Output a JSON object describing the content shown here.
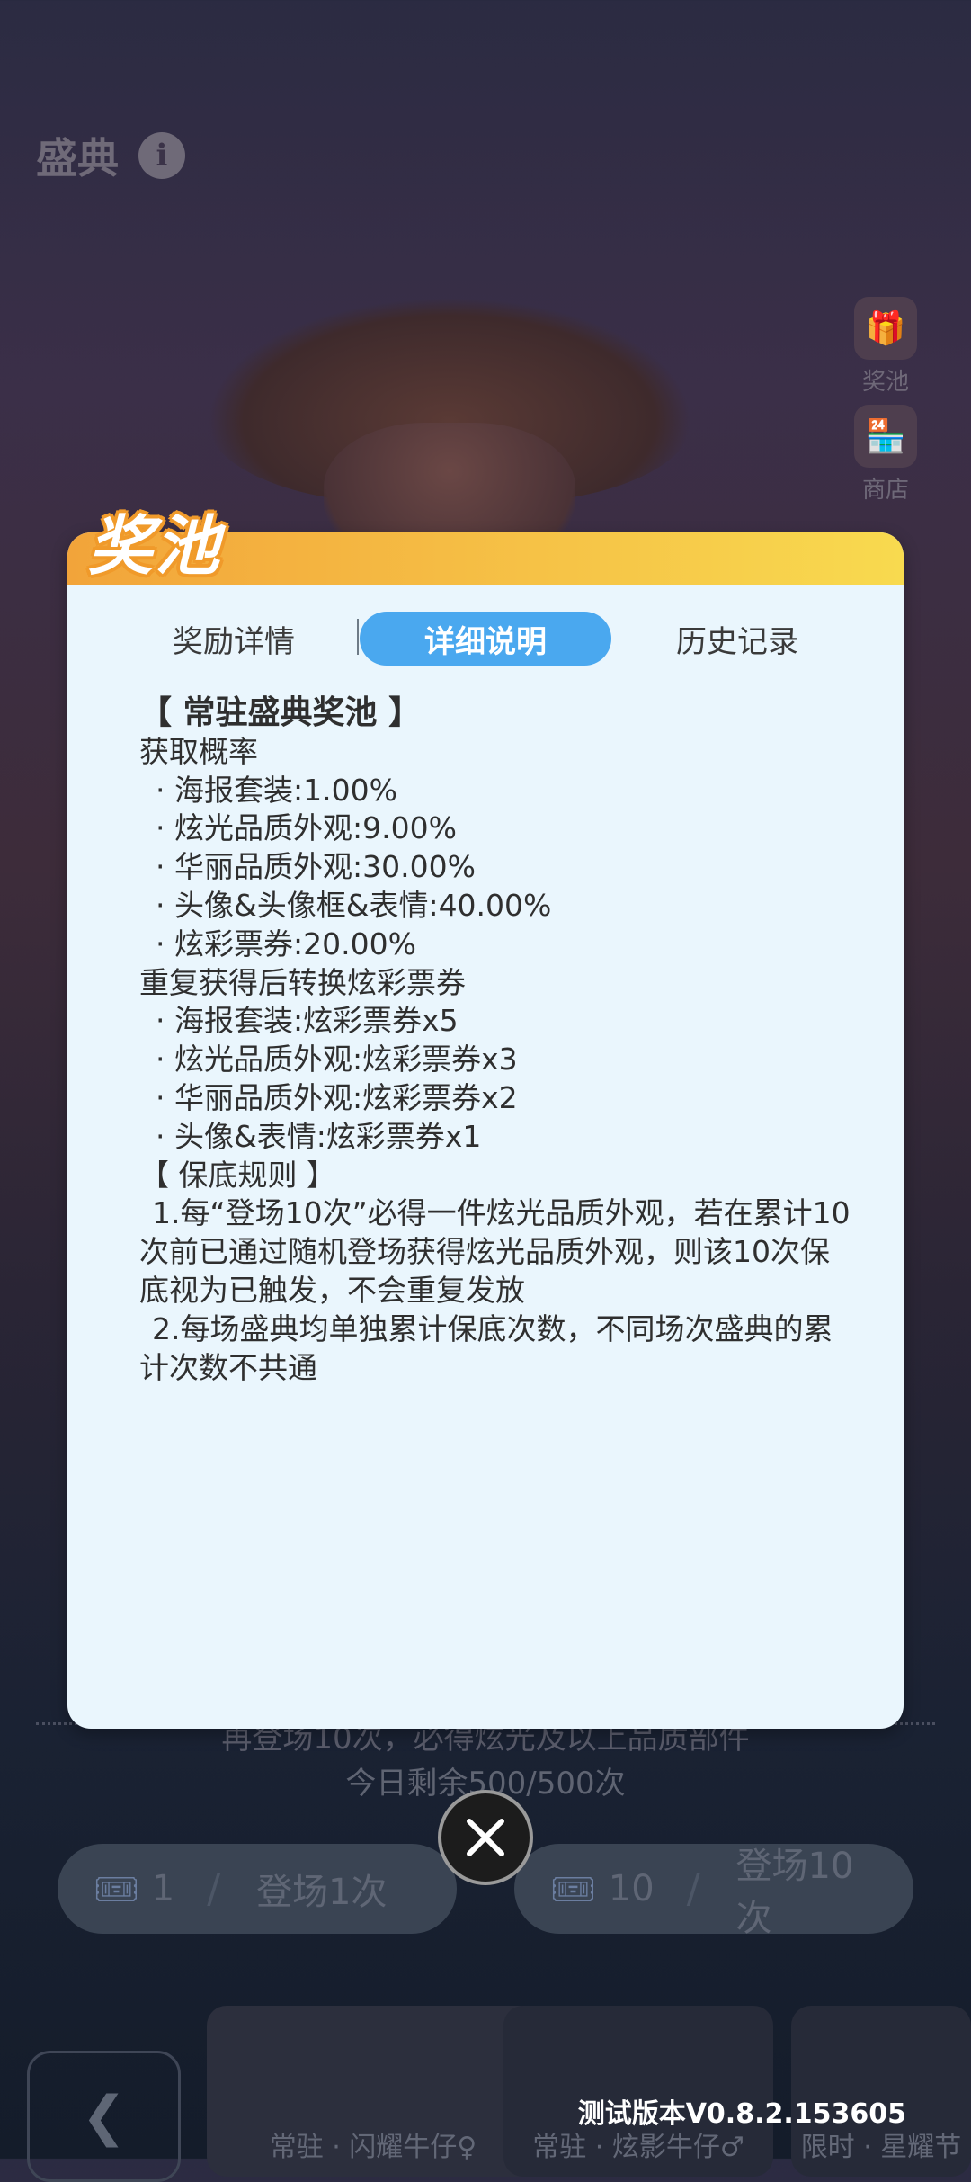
{
  "header": {
    "title": "盛典"
  },
  "side_buttons": [
    {
      "label": "奖池",
      "icon": "gift-icon"
    },
    {
      "label": "商店",
      "icon": "shop-icon"
    }
  ],
  "background": {
    "hint_text": "再登场10次，必得炫光及以上品质部件",
    "remaining": "今日剩余500/500次",
    "draw_one": {
      "count": "1",
      "label": "登场1次"
    },
    "draw_ten": {
      "count": "10",
      "label": "登场10次"
    },
    "cards": [
      "常驻 · 闪耀牛仔♀",
      "常驻 · 炫影牛仔♂",
      "限时 · 星耀节"
    ],
    "version": "测试版本V0.8.2.153605"
  },
  "modal": {
    "title": "奖池",
    "tabs": [
      "奖励详情",
      "详细说明",
      "历史记录"
    ],
    "active_tab": "详细说明",
    "section_title": "【 常驻盛典奖池 】",
    "prob_heading": "获取概率",
    "probabilities": [
      "· 海报套装:1.00%",
      "· 炫光品质外观:9.00%",
      "· 华丽品质外观:30.00%",
      "· 头像&头像框&表情:40.00%",
      "· 炫彩票券:20.00%"
    ],
    "convert_heading": "重复获得后转换炫彩票券",
    "conversions": [
      "· 海报套装:炫彩票券x5",
      "· 炫光品质外观:炫彩票券x3",
      "· 华丽品质外观:炫彩票券x2",
      "· 头像&表情:炫彩票券x1"
    ],
    "rules_heading": "【 保底规则 】",
    "rules": [
      "1.每“登场10次”必得一件炫光品质外观，若在累计10次前已通过随机登场获得炫光品质外观，则该10次保底视为已触发，不会重复发放",
      "2.每场盛典均单独累计保底次数，不同场次盛典的累计次数不共通"
    ]
  },
  "colors": {
    "accent": "#4aa8ef",
    "header_gradient_start": "#f2a43a",
    "header_gradient_end": "#f8da4f",
    "modal_bg": "#eaf6fd"
  }
}
